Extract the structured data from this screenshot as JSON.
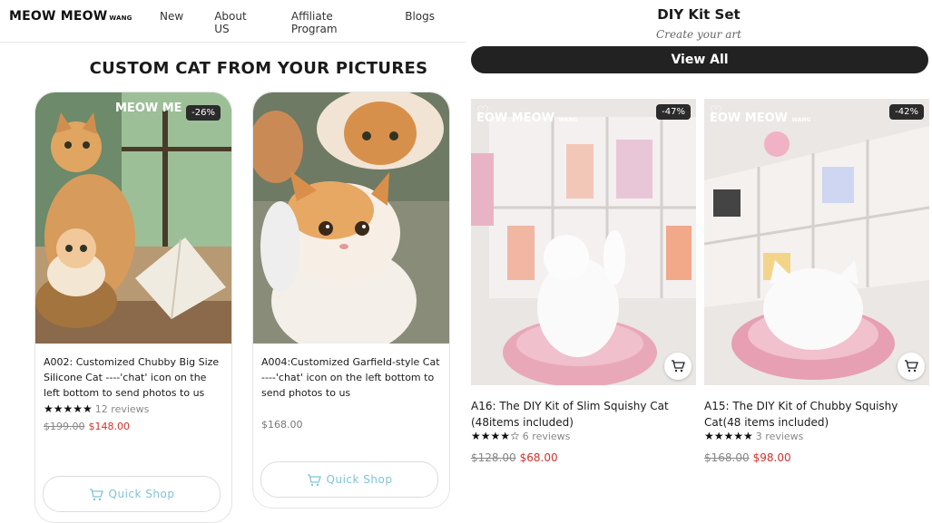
{
  "nav": {
    "logo": "MEOW MEOW",
    "logo_small": "WANG",
    "links": [
      "New",
      "About US",
      "Affiliate Program",
      "Blogs"
    ]
  },
  "left_section": {
    "title": "CUSTOM CAT FROM YOUR PICTURES",
    "products": [
      {
        "badge": "-26%",
        "watermark": "MEOW ME",
        "title": "A002: Customized Chubby Big Size Silicone Cat ----'chat' icon on the left bottom to send photos to us",
        "stars": "★★★★★",
        "reviews": "12 reviews",
        "price_old": "$199.00",
        "price_new": "$148.00",
        "quick_shop": "Quick Shop"
      },
      {
        "title": "A004:Customized Garfield-style Cat ----'chat' icon on the left bottom to send photos to us",
        "price": "$168.00",
        "quick_shop": "Quick Shop"
      }
    ]
  },
  "right_section": {
    "title": "DIY Kit Set",
    "subtitle": "Create your art",
    "view_all": "View All",
    "products": [
      {
        "badge": "-47%",
        "watermark": "EOW MEOW",
        "watermark_small": "WANG",
        "title": "A16: The DIY Kit of Slim Squishy Cat (48items included)",
        "stars": "★★★★☆",
        "reviews": "6 reviews",
        "price_old": "$128.00",
        "price_new": "$68.00"
      },
      {
        "badge": "-42%",
        "watermark": "EOW MEOW",
        "watermark_small": "WANG",
        "title": "A15: The DIY Kit of Chubby Squishy Cat(48 items included)",
        "stars": "★★★★★",
        "reviews": "3 reviews",
        "price_old": "$168.00",
        "price_new": "$98.00"
      }
    ]
  },
  "colors": {
    "sale_red": "#d0332d",
    "quick_shop_blue": "#7fc4d8",
    "dark_button": "#222222"
  },
  "icons": [
    "cart-icon",
    "heart-icon",
    "expand-icon"
  ]
}
